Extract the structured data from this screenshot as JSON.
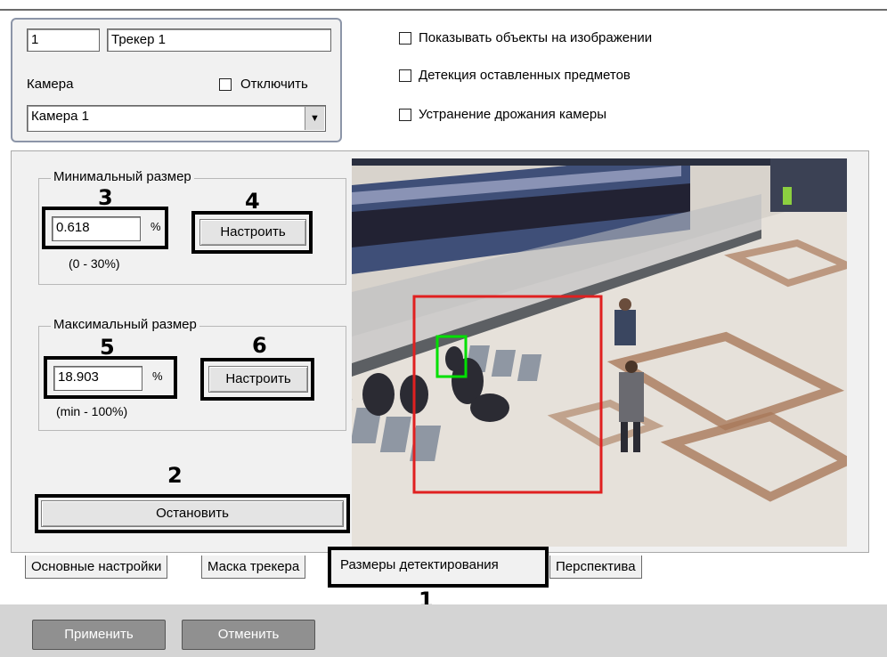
{
  "tracker": {
    "id": "1",
    "name": "Трекер 1"
  },
  "camera": {
    "label": "Камера",
    "disable_label": "Отключить",
    "selected": "Камера 1"
  },
  "options": [
    "Показывать объекты на изображении",
    "Детекция оставленных предметов",
    "Устранение дрожания камеры"
  ],
  "min_size": {
    "legend": "Минимальный размер",
    "value": "0.618",
    "unit": "%",
    "range": "(0 - 30%)",
    "button": "Настроить"
  },
  "max_size": {
    "legend": "Максимальный размер",
    "value": "18.903",
    "unit": "%",
    "range": "(min - 100%)",
    "button": "Настроить"
  },
  "stop_button": "Остановить",
  "tabs": [
    "Основные настройки",
    "Маска трекера",
    "Размеры детектирования",
    "Перспектива"
  ],
  "callouts": {
    "n1": "1",
    "n2": "2",
    "n3": "3",
    "n4": "4",
    "n5": "5",
    "n6": "6"
  },
  "footer": {
    "apply": "Применить",
    "cancel": "Отменить"
  },
  "colors": {
    "red_box": "#e02020",
    "green_box": "#00e000",
    "panel": "#f1f1f1"
  }
}
